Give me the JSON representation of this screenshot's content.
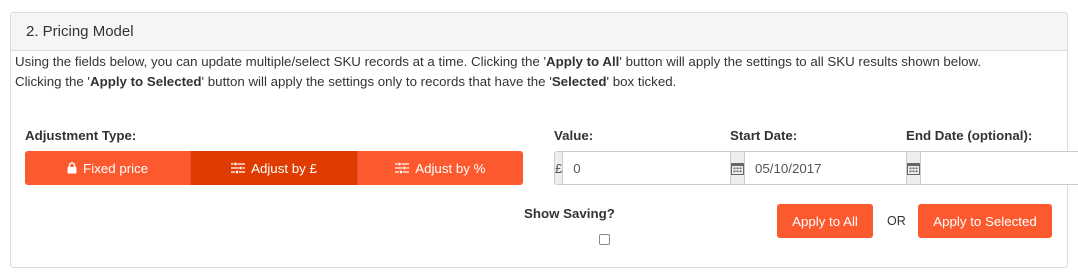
{
  "panel": {
    "heading": "2. Pricing Model",
    "desc": {
      "line1_a": "Using the fields below, you can update multiple/select SKU records at a time. Clicking the '",
      "line1_b": "Apply to All",
      "line1_c": "' button will apply the settings to all SKU results shown below.",
      "line2_a": "Clicking the '",
      "line2_b": "Apply to Selected",
      "line2_c": "' button will apply the settings only to records that have the '",
      "line2_d": "Selected",
      "line2_e": "' box ticked."
    }
  },
  "adjustment": {
    "label": "Adjustment Type:",
    "options": [
      {
        "label": "Fixed price",
        "icon": "lock-icon",
        "active": false
      },
      {
        "label": "Adjust by £",
        "icon": "sliders-icon",
        "active": true
      },
      {
        "label": "Adjust by %",
        "icon": "sliders-icon",
        "active": false
      }
    ]
  },
  "value": {
    "label": "Value:",
    "prefix": "£",
    "value": "0"
  },
  "start_date": {
    "label": "Start Date:",
    "icon": "calendar-icon",
    "value": "05/10/2017"
  },
  "end_date": {
    "label": "End Date (optional):",
    "icon": "calendar-icon",
    "value": ""
  },
  "show_saving": {
    "label": "Show Saving?",
    "checked": false
  },
  "actions": {
    "apply_all": "Apply to All",
    "or": "OR",
    "apply_selected": "Apply to Selected"
  },
  "colors": {
    "accent": "#fc5a2e",
    "accent_active": "#e03b00"
  }
}
